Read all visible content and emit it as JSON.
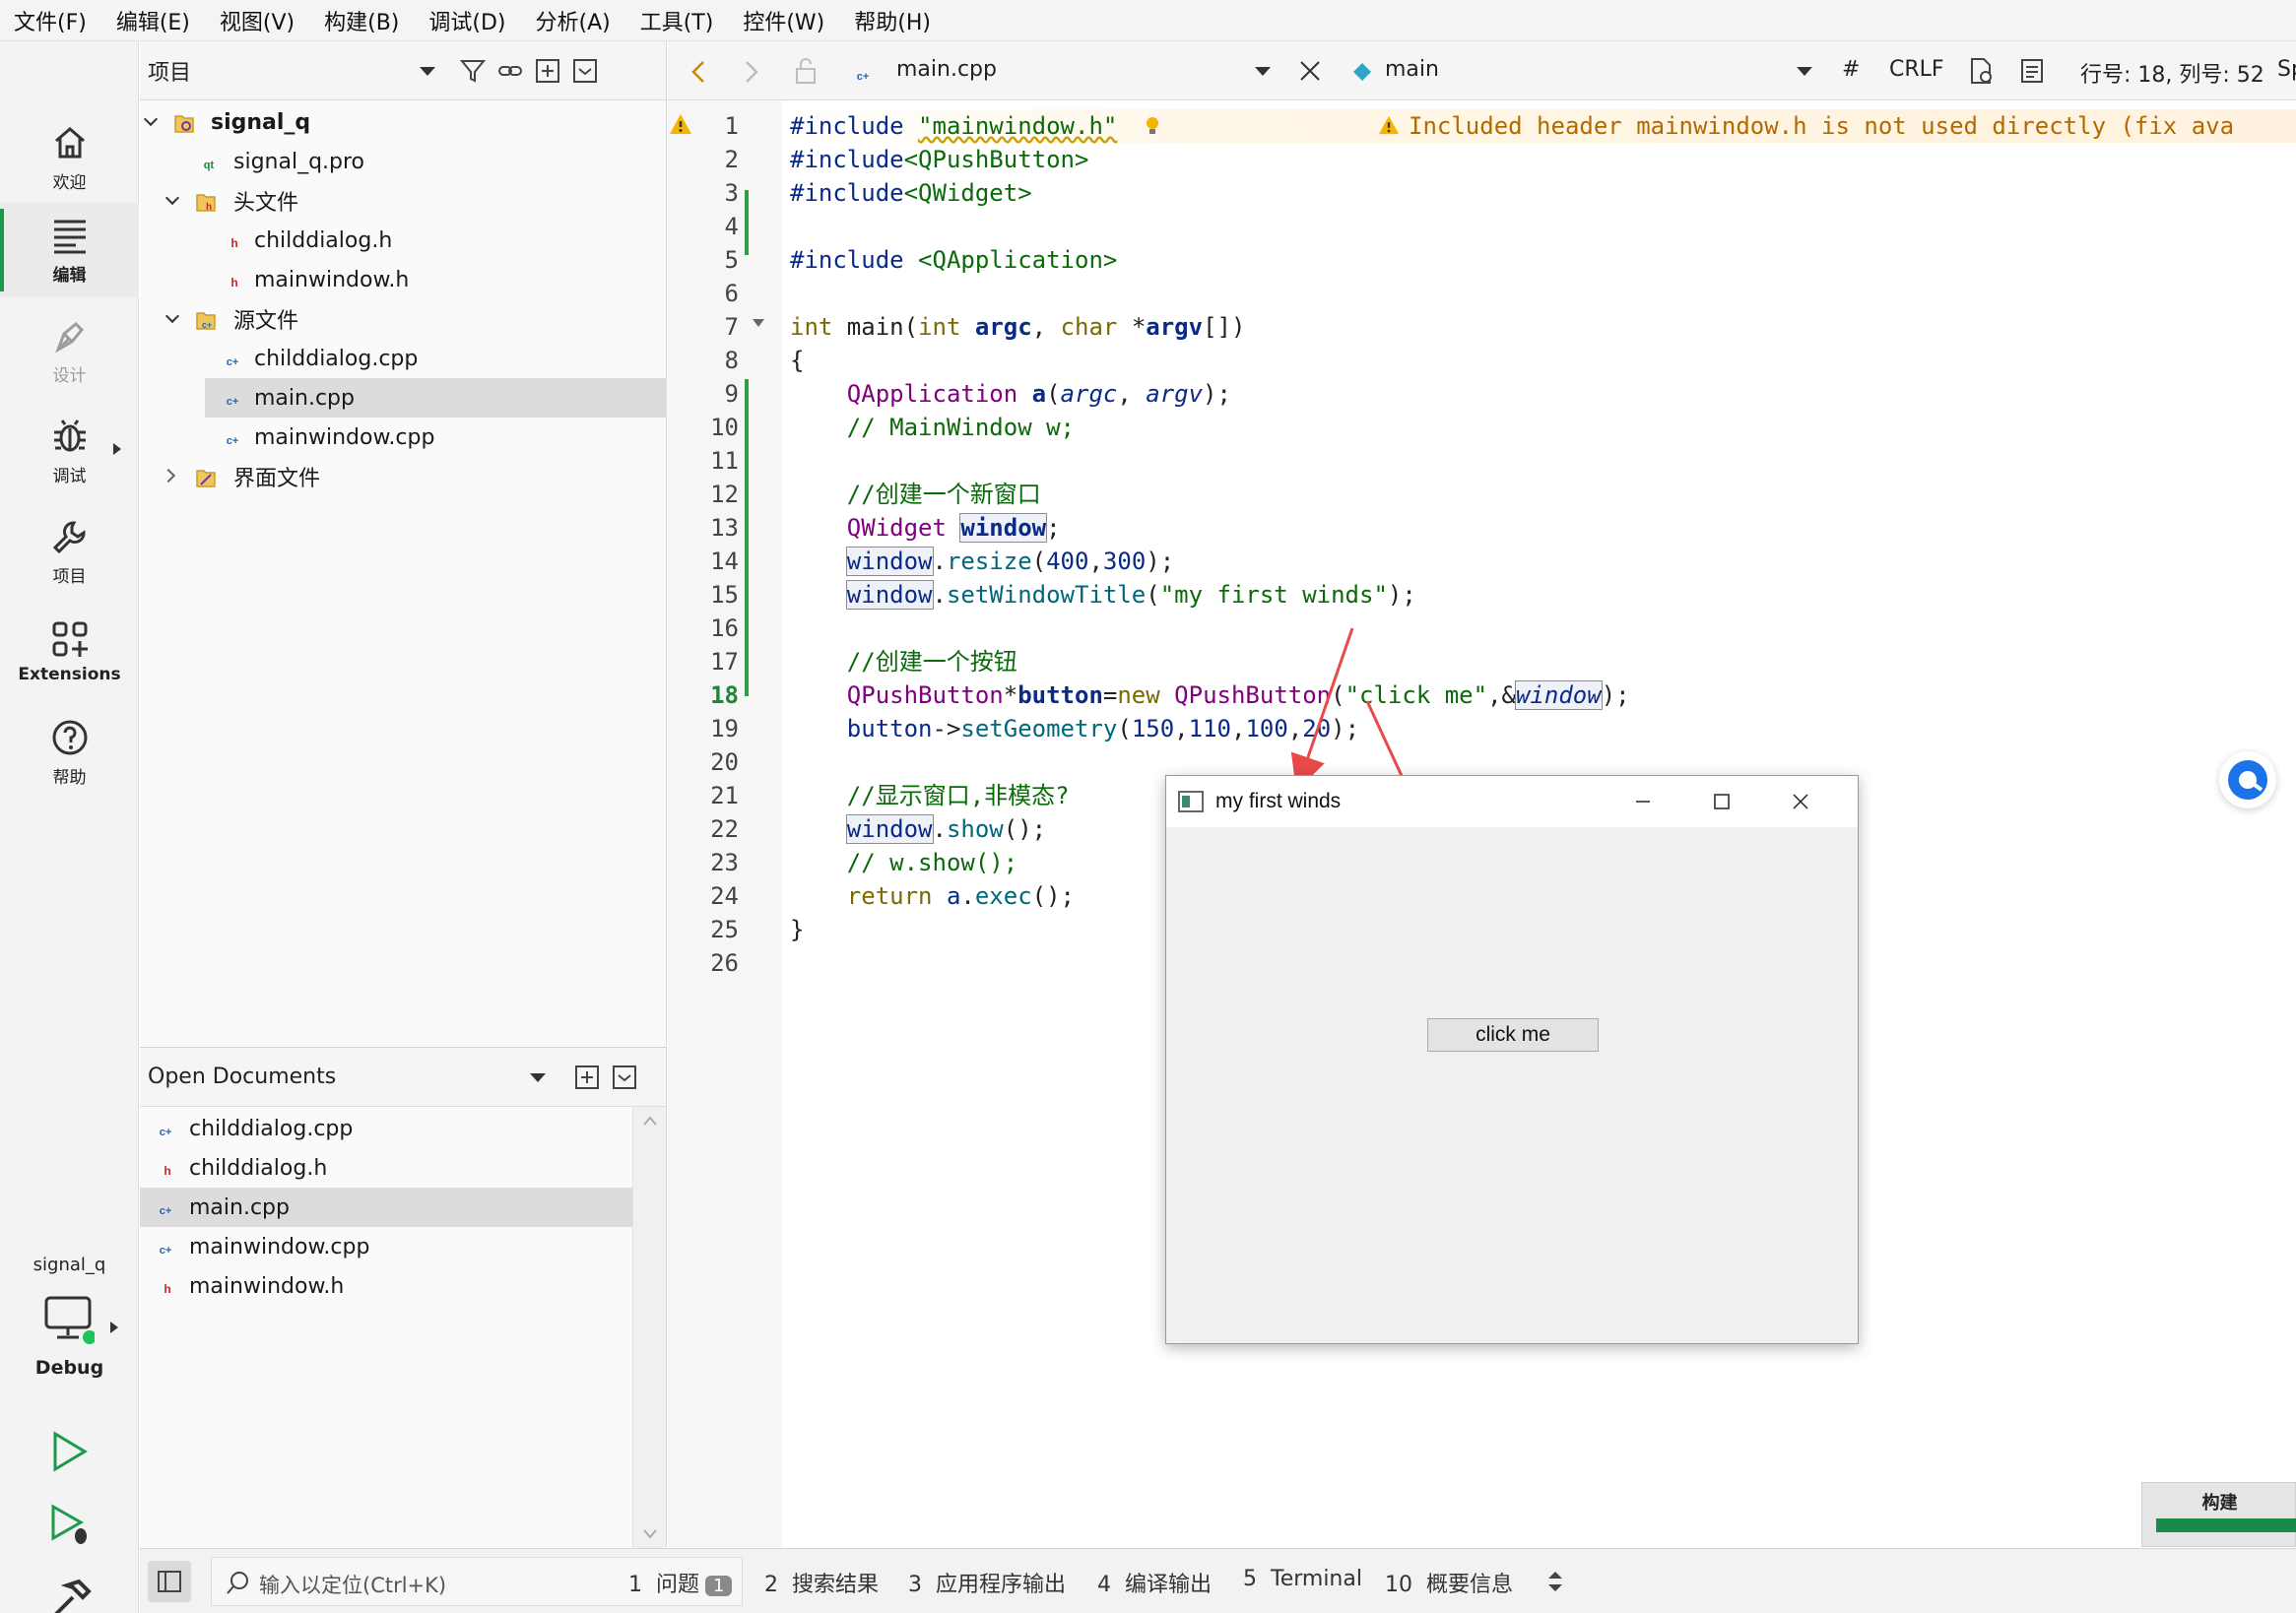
{
  "menu": [
    "文件(F)",
    "编辑(E)",
    "视图(V)",
    "构建(B)",
    "调试(D)",
    "分析(A)",
    "工具(T)",
    "控件(W)",
    "帮助(H)"
  ],
  "modes": [
    {
      "label": "欢迎",
      "icon": "home-icon"
    },
    {
      "label": "编辑",
      "icon": "edit-icon"
    },
    {
      "label": "设计",
      "icon": "design-icon"
    },
    {
      "label": "调试",
      "icon": "debug-icon"
    },
    {
      "label": "项目",
      "icon": "wrench-icon"
    },
    {
      "label": "Extensions",
      "icon": "extensions-icon"
    },
    {
      "label": "帮助",
      "icon": "help-icon"
    }
  ],
  "kit": {
    "project": "signal_q",
    "build_config": "Debug"
  },
  "project_pane": {
    "combo_label": "项目",
    "tree": [
      {
        "label": "signal_q",
        "type": "project"
      },
      {
        "label": "signal_q.pro",
        "type": "pro"
      },
      {
        "label": "头文件",
        "type": "folder-h"
      },
      {
        "label": "childdialog.h",
        "type": "h"
      },
      {
        "label": "mainwindow.h",
        "type": "h"
      },
      {
        "label": "源文件",
        "type": "folder-cpp"
      },
      {
        "label": "childdialog.cpp",
        "type": "cpp"
      },
      {
        "label": "main.cpp",
        "type": "cpp",
        "selected": true
      },
      {
        "label": "mainwindow.cpp",
        "type": "cpp"
      },
      {
        "label": "界面文件",
        "type": "folder-ui"
      }
    ]
  },
  "open_documents": {
    "combo_label": "Open Documents",
    "files": [
      "childdialog.cpp",
      "childdialog.h",
      "main.cpp",
      "mainwindow.cpp",
      "mainwindow.h"
    ],
    "selected": "main.cpp"
  },
  "editor_toolbar": {
    "file_name": "main.cpp",
    "symbol": "main",
    "hash": "#",
    "line_ending": "CRLF",
    "position": "行号: 18, 列号: 52",
    "trailing": "Sp"
  },
  "editor": {
    "current_line": 18,
    "warning": "Included header mainwindow.h is not used directly (fix ava",
    "line_numbers": [
      "1",
      "2",
      "3",
      "4",
      "5",
      "6",
      "7",
      "8",
      "9",
      "10",
      "11",
      "12",
      "13",
      "14",
      "15",
      "16",
      "17",
      "18",
      "19",
      "20",
      "21",
      "22",
      "23",
      "24",
      "25",
      "26"
    ]
  },
  "popup": {
    "title": "my first winds",
    "button_label": "click me"
  },
  "bottom": {
    "locator_placeholder": "输入以定位(Ctrl+K)",
    "tabs": [
      {
        "num": "1",
        "label": "问题",
        "badge": "1"
      },
      {
        "num": "2",
        "label": "搜索结果"
      },
      {
        "num": "3",
        "label": "应用程序输出"
      },
      {
        "num": "4",
        "label": "编译输出"
      },
      {
        "num": "5",
        "label": "Terminal"
      },
      {
        "num": "10",
        "label": "概要信息"
      }
    ]
  },
  "build_progress": {
    "label": "构建",
    "progress": 1.0
  },
  "colors": {
    "accent_green": "#1a9a4a",
    "warning_orange": "#b26a00",
    "arrow_red": "#e84a4a"
  }
}
